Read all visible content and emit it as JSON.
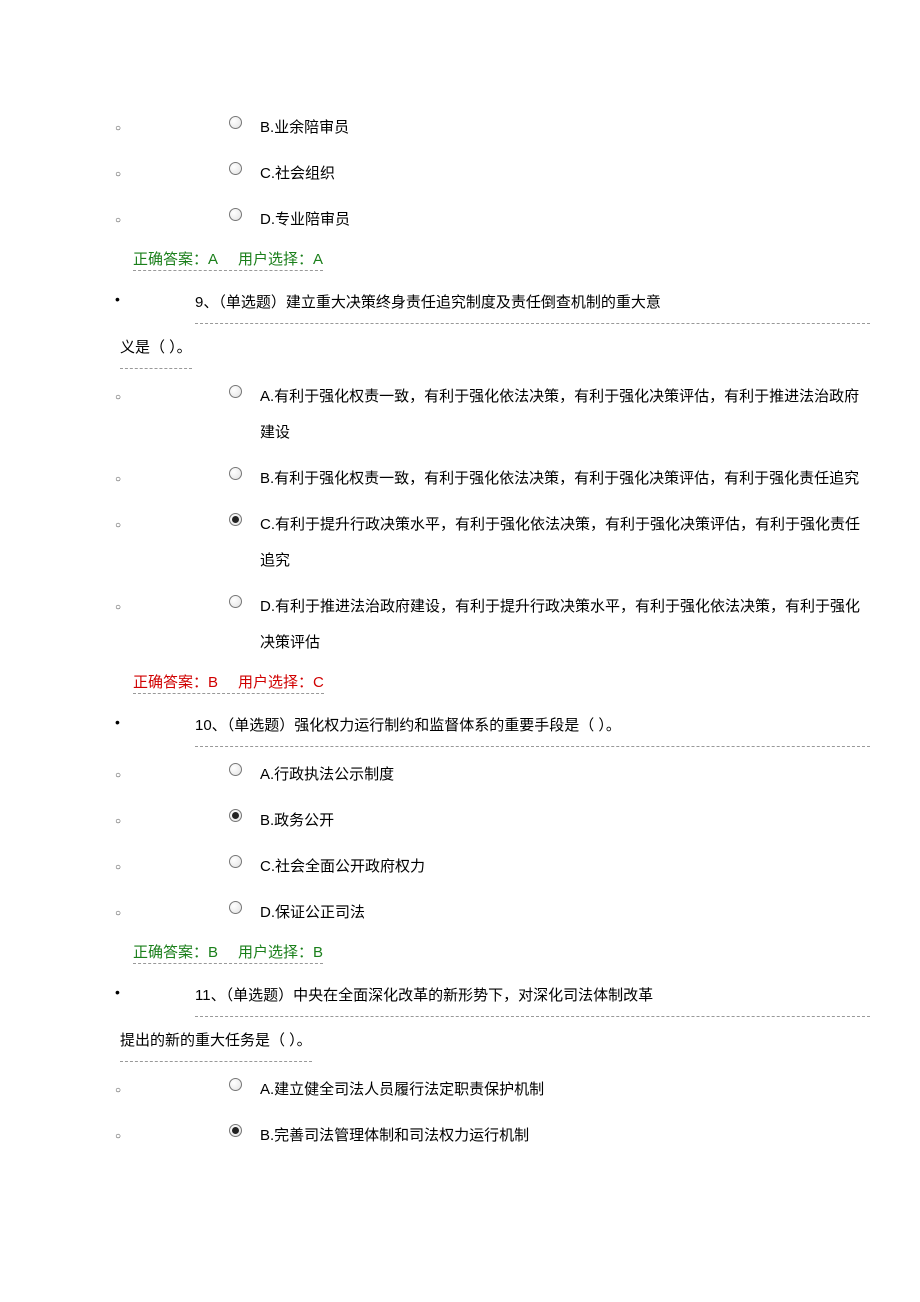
{
  "q8_options": {
    "b": "B.业余陪审员",
    "c": "C.社会组织",
    "d": "D.专业陪审员"
  },
  "q8_answer": {
    "correct_label": "正确答案：",
    "correct_value": "A",
    "user_label": "用户选择：",
    "user_value": "A",
    "status": "correct"
  },
  "q9": {
    "number": "9、",
    "type": "（单选题）",
    "text_line1": "建立重大决策终身责任追究制度及责任倒查机制的重大意",
    "text_line2": "义是（ ）。",
    "options": {
      "a": "A.有利于强化权责一致，有利于强化依法决策，有利于强化决策评估，有利于推进法治政府建设",
      "b": "B.有利于强化权责一致，有利于强化依法决策，有利于强化决策评估，有利于强化责任追究",
      "c": "C.有利于提升行政决策水平，有利于强化依法决策，有利于强化决策评估，有利于强化责任追究",
      "d": "D.有利于推进法治政府建设，有利于提升行政决策水平，有利于强化依法决策，有利于强化决策评估"
    },
    "answer": {
      "correct_label": "正确答案：",
      "correct_value": "B",
      "user_label": "用户选择：",
      "user_value": "C",
      "status": "wrong"
    }
  },
  "q10": {
    "number": "10、",
    "type": "（单选题）",
    "text": "强化权力运行制约和监督体系的重要手段是（ ）。",
    "options": {
      "a": "A.行政执法公示制度",
      "b": "B.政务公开",
      "c": "C.社会全面公开政府权力",
      "d": "D.保证公正司法"
    },
    "answer": {
      "correct_label": "正确答案：",
      "correct_value": "B",
      "user_label": "用户选择：",
      "user_value": "B",
      "status": "correct"
    }
  },
  "q11": {
    "number": "11、",
    "type": "（单选题）",
    "text_line1": "中央在全面深化改革的新形势下，对深化司法体制改革",
    "text_line2": "提出的新的重大任务是（ ）。",
    "options": {
      "a": "A.建立健全司法人员履行法定职责保护机制",
      "b": "B.完善司法管理体制和司法权力运行机制"
    }
  }
}
